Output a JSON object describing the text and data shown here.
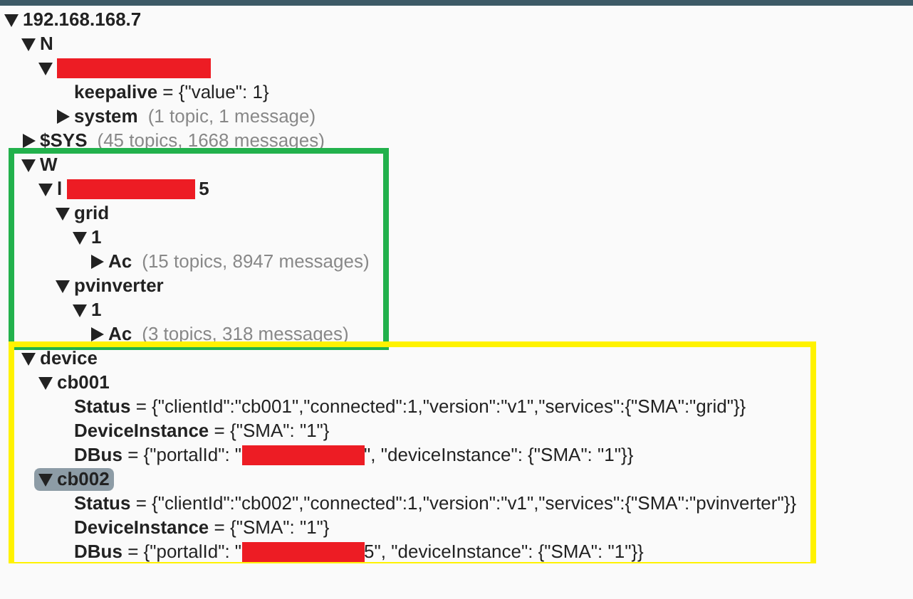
{
  "tree": [
    {
      "name": "192.168.168.7",
      "expanded": true,
      "selected": false,
      "children": [
        {
          "name": "N",
          "expanded": true,
          "selected": false,
          "children": [
            {
              "redacted": true,
              "expanded": true,
              "selected": false,
              "children": [
                {
                  "name": "keepalive",
                  "value": "= {\"value\": 1}",
                  "selected": false
                },
                {
                  "name": "system",
                  "summary": "(1 topic, 1 message)",
                  "expanded": false,
                  "selected": false
                }
              ]
            }
          ]
        },
        {
          "name": "$SYS",
          "summary": "(45 topics, 1668 messages)",
          "expanded": false,
          "selected": false
        },
        {
          "name": "W",
          "expanded": true,
          "selected": false,
          "color": "#22b14c",
          "children": [
            {
              "name": "l",
              "redacted": true,
              "name_tail": "5",
              "expanded": true,
              "selected": false,
              "children": [
                {
                  "name": "grid",
                  "expanded": true,
                  "selected": false,
                  "children": [
                    {
                      "name": "1",
                      "expanded": true,
                      "selected": false,
                      "children": [
                        {
                          "name": "Ac",
                          "summary": "(15 topics, 8947 messages)",
                          "expanded": false,
                          "selected": false
                        }
                      ]
                    }
                  ]
                },
                {
                  "name": "pvinverter",
                  "expanded": true,
                  "selected": false,
                  "children": [
                    {
                      "name": "1",
                      "expanded": true,
                      "selected": false,
                      "children": [
                        {
                          "name": "Ac",
                          "summary": "(3 topics, 318 messages)",
                          "expanded": false,
                          "selected": false
                        }
                      ]
                    }
                  ]
                }
              ]
            }
          ]
        },
        {
          "name": "device",
          "expanded": true,
          "selected": false,
          "color": "#fff200",
          "children": [
            {
              "name": "cb001",
              "expanded": true,
              "selected": false,
              "children": [
                {
                  "name": "Status",
                  "value": "= {\"clientId\":\"cb001\",\"connected\":1,\"version\":\"v1\",\"services\":{\"SMA\":\"grid\"}}",
                  "selected": false
                },
                {
                  "name": "DeviceInstance",
                  "value": "= {\"SMA\": \"1\"}",
                  "selected": false
                },
                {
                  "name": "DBus",
                  "value": "= {\"portalId\": \"",
                  "redacted": true,
                  "value_tail": "\", \"deviceInstance\": {\"SMA\": \"1\"}}",
                  "selected": false
                }
              ]
            },
            {
              "name": "cb002",
              "expanded": true,
              "selected": true,
              "children": [
                {
                  "name": "Status",
                  "value": "= {\"clientId\":\"cb002\",\"connected\":1,\"version\":\"v1\",\"services\":{\"SMA\":\"pvinverter\"}}",
                  "selected": false
                },
                {
                  "name": "DeviceInstance",
                  "value": "= {\"SMA\": \"1\"}",
                  "selected": false
                },
                {
                  "name": "DBus",
                  "value": "= {\"portalId\": \"",
                  "redacted": true,
                  "value_tail": "5\", \"deviceInstance\": {\"SMA\": \"1\"}}",
                  "selected": false
                }
              ]
            }
          ]
        }
      ]
    }
  ]
}
